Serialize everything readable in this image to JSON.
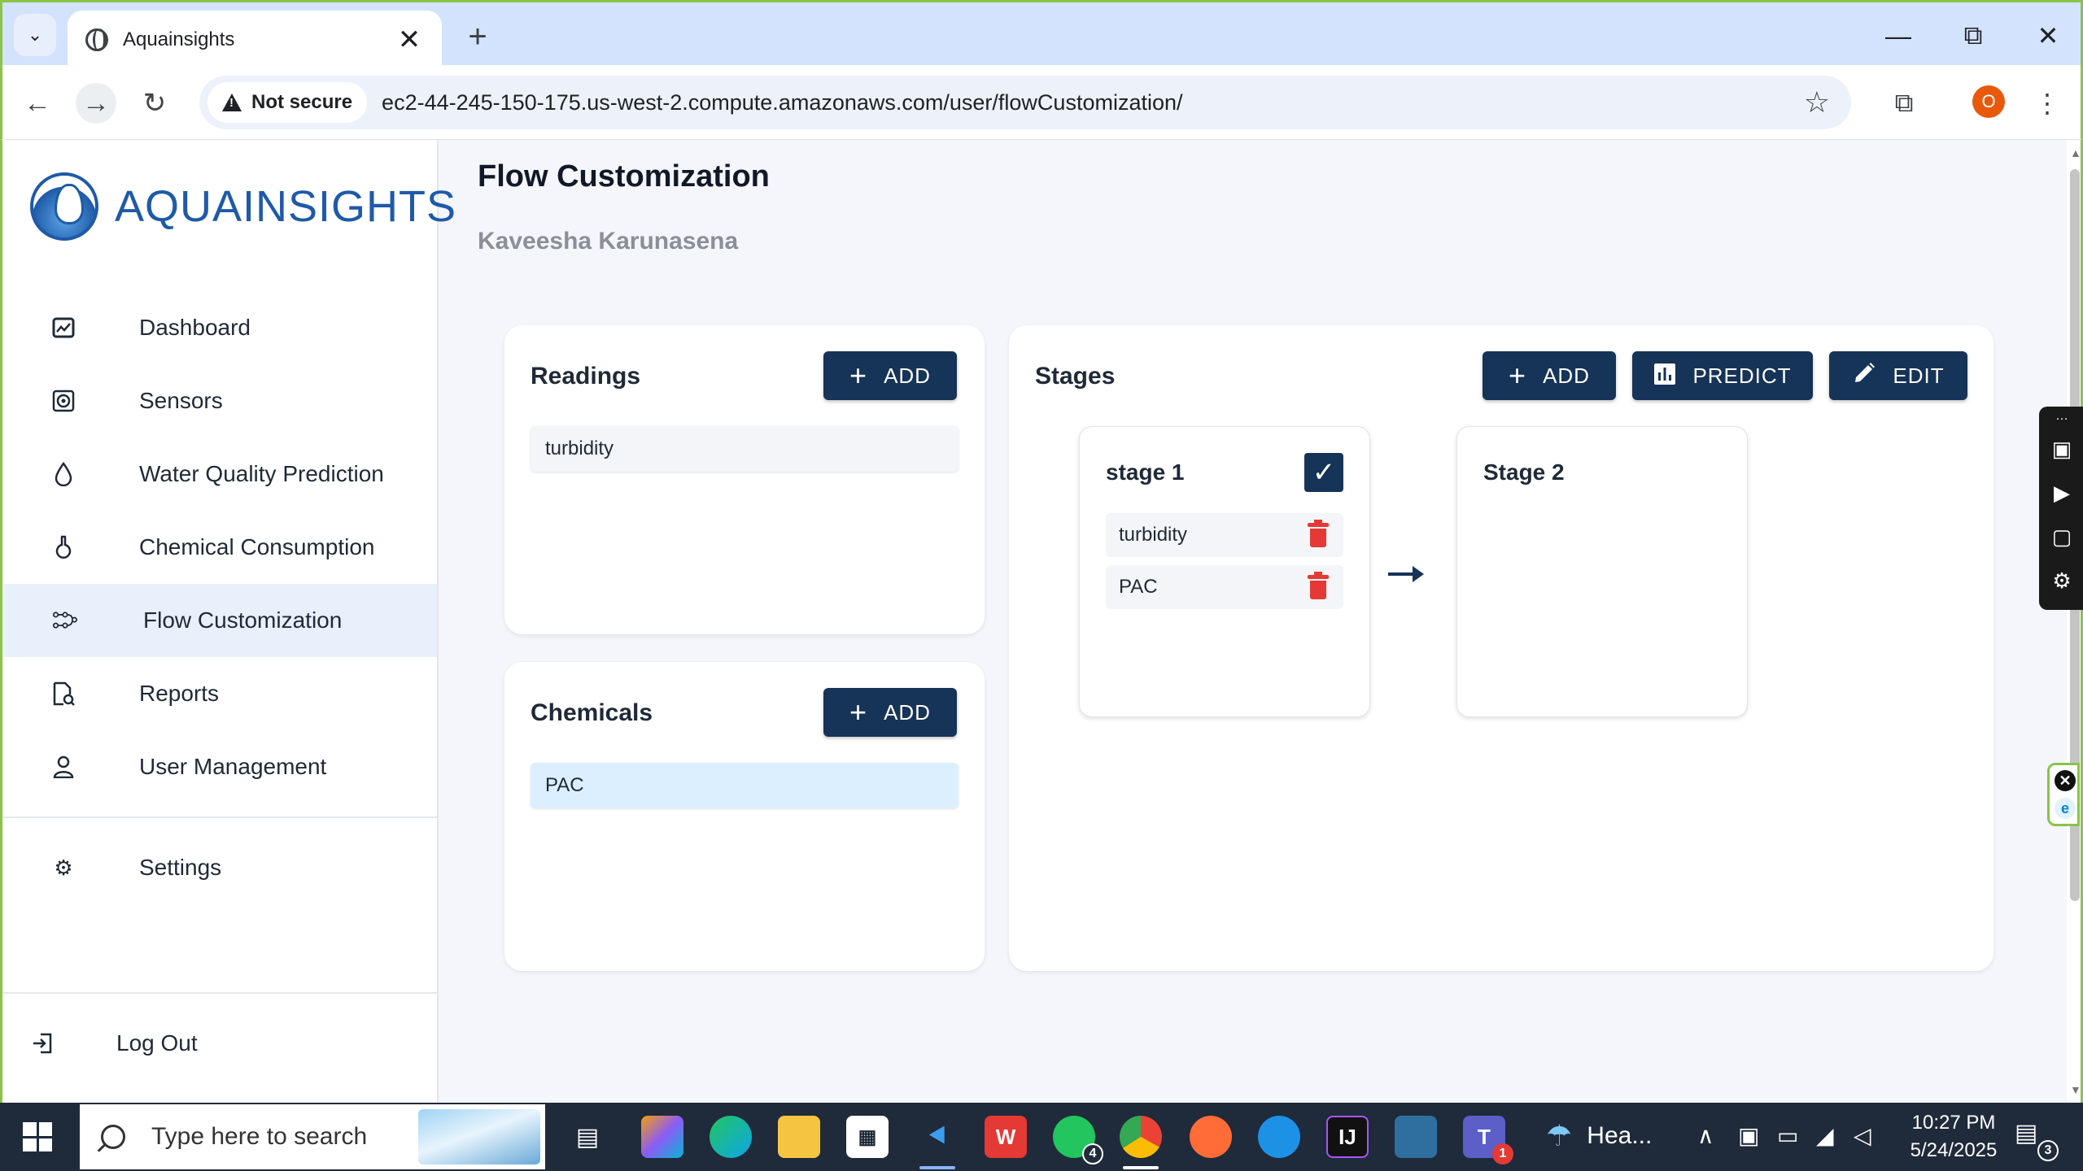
{
  "browser": {
    "tab_title": "Aquainsights",
    "security_label": "Not secure",
    "url": "ec2-44-245-150-175.us-west-2.compute.amazonaws.com/user/flowCustomization/",
    "profile_initial": "O"
  },
  "sidebar": {
    "logo_text": "AQUAINSIGHTS",
    "items": [
      {
        "label": "Dashboard",
        "icon": "dashboard-icon"
      },
      {
        "label": "Sensors",
        "icon": "sensor-icon"
      },
      {
        "label": "Water Quality Prediction",
        "icon": "drop-icon"
      },
      {
        "label": "Chemical Consumption",
        "icon": "flask-icon"
      },
      {
        "label": "Flow Customization",
        "icon": "flow-icon",
        "active": true
      },
      {
        "label": "Reports",
        "icon": "report-icon"
      },
      {
        "label": "User Management",
        "icon": "user-icon"
      }
    ],
    "settings_label": "Settings",
    "logout_label": "Log Out"
  },
  "main": {
    "title": "Flow Customization",
    "user_name": "Kaveesha Karunasena",
    "readings": {
      "title": "Readings",
      "add_label": "ADD",
      "items": [
        "turbidity"
      ]
    },
    "chemicals": {
      "title": "Chemicals",
      "add_label": "ADD",
      "items": [
        "PAC"
      ]
    },
    "stages": {
      "title": "Stages",
      "add_label": "ADD",
      "predict_label": "PREDICT",
      "edit_label": "EDIT",
      "list": [
        {
          "name": "stage 1",
          "checked": true,
          "items": [
            "turbidity",
            "PAC"
          ]
        },
        {
          "name": "Stage 2",
          "checked": false,
          "items": []
        }
      ]
    }
  },
  "taskbar": {
    "search_placeholder": "Type here to search",
    "weather_text": "Hea...",
    "time": "10:27 PM",
    "date": "5/24/2025",
    "whatsapp_badge": "4",
    "teams_badge": "1",
    "notification_count": "3"
  },
  "colors": {
    "primary": "#163358",
    "accent_blue": "#1e5aa8",
    "delete_red": "#e53935",
    "active_nav_bg": "#e8f0fb"
  }
}
